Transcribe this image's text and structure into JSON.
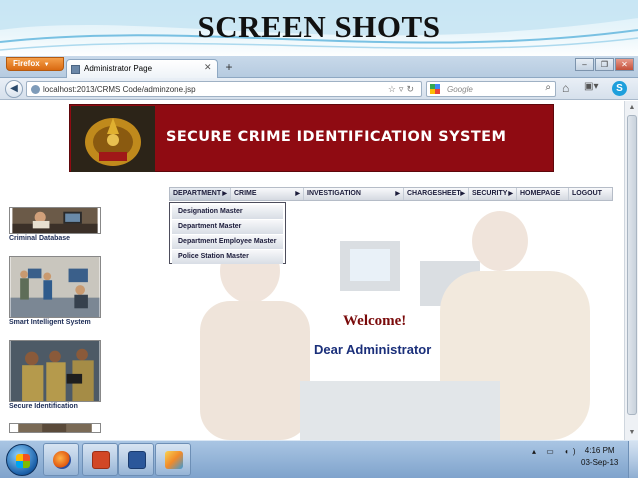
{
  "slide": {
    "title": "SCREEN SHOTS"
  },
  "browser": {
    "menu_button": "Firefox",
    "tab_title": "Administrator Page",
    "url": "localhost:2013/CRMS Code/adminzone.jsp",
    "search_placeholder": "Google"
  },
  "page": {
    "banner_title": "SECURE CRIME IDENTIFICATION SYSTEM",
    "menu": [
      "DEPARTMENT",
      "CRIME",
      "INVESTIGATION",
      "CHARGESHEET",
      "SECURITY",
      "HOMEPAGE",
      "LOGOUT"
    ],
    "dropdown": [
      "Designation Master",
      "Department Master",
      "Department Employee Master",
      "Police Station Master"
    ],
    "sidebar": [
      {
        "label": "Criminal Database"
      },
      {
        "label": "Smart Intelligent System"
      },
      {
        "label": "Secure Identification"
      }
    ],
    "welcome": "Welcome!",
    "greeting": "Dear Administrator"
  },
  "taskbar": {
    "time": "4:16 PM",
    "date": "03-Sep-13"
  },
  "colors": {
    "banner": "#8f0b12",
    "welcome": "#7a0a0a",
    "greeting": "#1a2f7a"
  }
}
